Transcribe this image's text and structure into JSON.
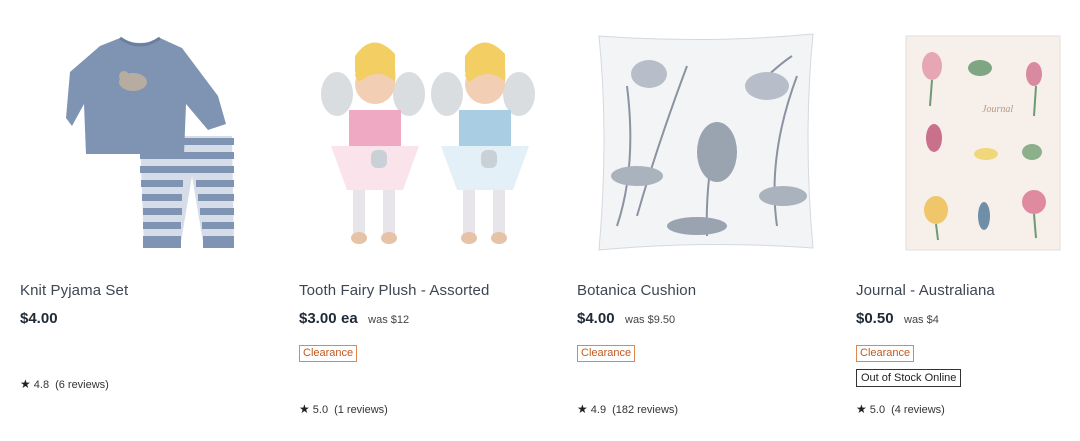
{
  "products": [
    {
      "title": "Knit Pyjama Set",
      "price": "$4.00",
      "price_suffix": "",
      "was": "",
      "badge": "",
      "stock": "",
      "rating": "4.8",
      "reviews": "(6 reviews)"
    },
    {
      "title": "Tooth Fairy Plush - Assorted",
      "price": "$3.00",
      "price_suffix": "ea",
      "was": "was $12",
      "badge": "Clearance",
      "stock": "",
      "rating": "5.0",
      "reviews": "(1 reviews)"
    },
    {
      "title": "Botanica Cushion",
      "price": "$4.00",
      "price_suffix": "",
      "was": "was $9.50",
      "badge": "Clearance",
      "stock": "",
      "rating": "4.9",
      "reviews": "(182 reviews)"
    },
    {
      "title": "Journal - Australiana",
      "price": "$0.50",
      "price_suffix": "",
      "was": "was $4",
      "badge": "Clearance",
      "stock": "Out of Stock Online",
      "rating": "5.0",
      "reviews": "(4 reviews)"
    }
  ],
  "journal_cover_text": "Journal",
  "icons": {
    "rating": "star-icon"
  },
  "colors": {
    "clearance": "#c05a1e",
    "text": "#1f2a36"
  }
}
